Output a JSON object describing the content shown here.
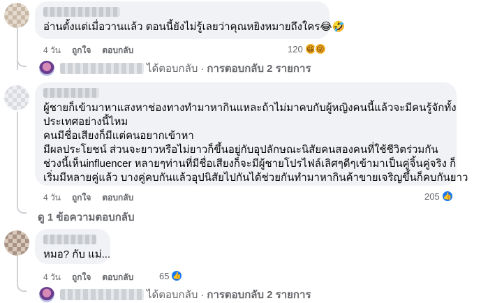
{
  "comments": [
    {
      "text": [
        "อ่านตั้งแต่เมื่อวานแล้ว ตอนนี้ยังไม่รู้เลยว่าคุณหยิงหมายถึงใคร😂🤣"
      ],
      "time": "4 วัน",
      "like_label": "ถูกใจ",
      "reply_label": "ตอบกลับ",
      "reaction_count": "120",
      "reaction_icons": [
        "haha-icon",
        "laugh-tongue-icon"
      ]
    },
    {
      "text": [
        "ผู้ชายก็เข้ามาหาแสงหาช่องทางทำมาหากินแหละถ้าไม่มาคบกับผู้หญิงคนนี้แล้วจะมีคนรู้จักทั้ง",
        "ประเทศอย่างนี้ไหม",
        "คนมีชื่อเสียงก็มีแต่คนอยากเข้าหา",
        "มีผลประโยชน์ ส่วนจะยาวหรือไม่ยาวก็ขึ้นอยู่กับอุปลักษณะนิสัยคนสองคนที่ใช้ชีวิตร่วมกัน",
        "ช่วงนี้เห็นinfluencer หลายๆท่านที่มีชื่อเสียงก็จะมีผู้ชายโปรไฟล์เลิศๆดีๆเข้ามาเป็นคู่จิ้นคู่จริง ก็",
        "เริ่มมีหลายคู่แล้ว บางคู่คบกันแล้วอุปนิสัยไปกันได้ช่วยกันทำมาหากินค้าขายเจริญขึ้นก็คบกันยาว"
      ],
      "time": "4 วัน",
      "like_label": "ถูกใจ",
      "reply_label": "ตอบกลับ",
      "reaction_count": "205",
      "reaction_icons": [
        "like-icon"
      ]
    },
    {
      "text": [
        "หมอ? กับ แม่..."
      ],
      "time": "4 วัน",
      "like_label": "ถูกใจ",
      "reply_label": "ตอบกลับ",
      "reaction_count": "65",
      "reaction_icons": [
        "like-icon"
      ]
    }
  ],
  "reply_summary": {
    "replied_label": "ได้ตอบกลับ",
    "separator": "·",
    "count_label": "การตอบกลับ 2 รายการ"
  },
  "more_replies_label": "ดู 1 ข้อความตอบกลับ",
  "colors": {
    "bubble": "#f0f2f5",
    "secondary_text": "#65676b",
    "like_blue": "#1877f2",
    "haha_yellow": "#f7b125"
  }
}
